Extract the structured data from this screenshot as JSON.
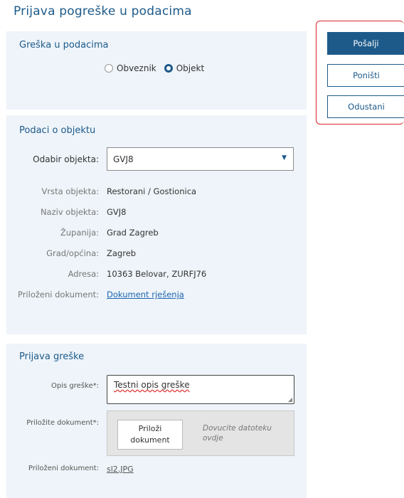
{
  "page": {
    "title": "Prijava pogreške u podacima"
  },
  "greska_panel": {
    "title": "Greška u podacima",
    "radios": [
      {
        "label": "Obveznik",
        "checked": false
      },
      {
        "label": "Objekt",
        "checked": true
      }
    ]
  },
  "podaci_panel": {
    "title": "Podaci o objektu",
    "select_label": "Odabir objekta:",
    "select_value": "GVJ8",
    "rows": [
      {
        "label": "Vrsta objekta:",
        "value": "Restorani / Gostionica"
      },
      {
        "label": "Naziv objekta:",
        "value": "GVJ8"
      },
      {
        "label": "Županija:",
        "value": "Grad Zagreb"
      },
      {
        "label": "Grad/općina:",
        "value": "Zagreb"
      },
      {
        "label": "Adresa:",
        "value": "10363 Belovar, ZURFJ76"
      },
      {
        "label": "Priloženi dokument:",
        "value": "Dokument rješenja"
      }
    ]
  },
  "prijava_panel": {
    "title": "Prijava greške",
    "opis_label": "Opis greške*:",
    "opis_value": "Testni opis greške",
    "prilozite_label": "Priložite dokument*:",
    "attach_button": "Priloži dokument",
    "drop_hint": "Dovucite datoteku ovdje",
    "prilozeni_label": "Priloženi dokument:",
    "prilozeni_value": "sl2.JPG"
  },
  "actions": {
    "send": "Pošalji",
    "reset": "Poništi",
    "cancel": "Odustani"
  },
  "colors": {
    "accent": "#1d5a8a",
    "panel_bg": "#eef4f9",
    "highlight": "#d9262b"
  }
}
